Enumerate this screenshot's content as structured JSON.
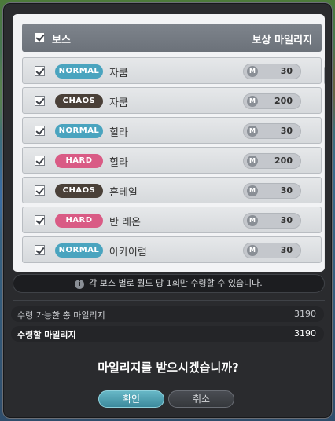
{
  "header": {
    "boss_label": "보스",
    "reward_label": "보상 마일리지"
  },
  "rows": [
    {
      "difficulty": "NORMAL",
      "boss": "자쿰",
      "mileage": "30",
      "badge_color": "#4aa4bf"
    },
    {
      "difficulty": "CHAOS",
      "boss": "자쿰",
      "mileage": "200",
      "badge_color": "#4a4038"
    },
    {
      "difficulty": "NORMAL",
      "boss": "힐라",
      "mileage": "30",
      "badge_color": "#4aa4bf"
    },
    {
      "difficulty": "HARD",
      "boss": "힐라",
      "mileage": "200",
      "badge_color": "#d95b85"
    },
    {
      "difficulty": "CHAOS",
      "boss": "혼테일",
      "mileage": "30",
      "badge_color": "#4a4038"
    },
    {
      "difficulty": "HARD",
      "boss": "반 레온",
      "mileage": "30",
      "badge_color": "#d95b85"
    },
    {
      "difficulty": "NORMAL",
      "boss": "아카이럼",
      "mileage": "30",
      "badge_color": "#4aa4bf"
    }
  ],
  "mileage_icon_text": "M",
  "notice": "각 보스 별로 월드 당 1회만 수령할 수 있습니다.",
  "stats": {
    "available_label": "수령 가능한 총 마일리지",
    "available_value": "3190",
    "receive_label": "수령할 마일리지",
    "receive_value": "3190"
  },
  "question": "마일리지를 받으시겠습니까?",
  "buttons": {
    "ok": "확인",
    "cancel": "취소"
  }
}
